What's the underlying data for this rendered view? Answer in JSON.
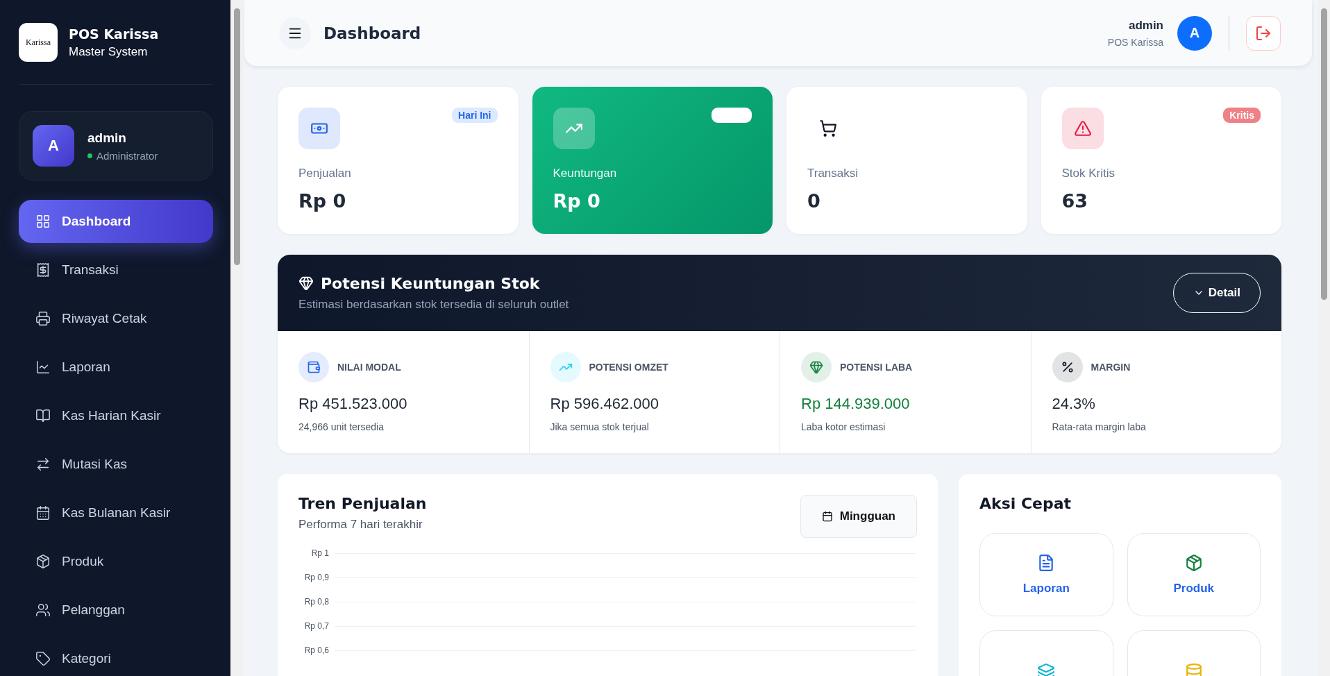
{
  "sidebar": {
    "brand": {
      "logo_text": "Karissa",
      "title": "POS Karissa",
      "subtitle": "Master System"
    },
    "user": {
      "initial": "A",
      "name": "admin",
      "role": "Administrator",
      "online": true
    },
    "items": [
      {
        "label": "Dashboard",
        "selected": true
      },
      {
        "label": "Transaksi",
        "selected": false
      },
      {
        "label": "Riwayat Cetak",
        "selected": false
      },
      {
        "label": "Laporan",
        "selected": false
      },
      {
        "label": "Kas Harian Kasir",
        "selected": false
      },
      {
        "label": "Mutasi Kas",
        "selected": false
      },
      {
        "label": "Kas Bulanan Kasir",
        "selected": false
      },
      {
        "label": "Produk",
        "selected": false
      },
      {
        "label": "Pelanggan",
        "selected": false
      },
      {
        "label": "Kategori",
        "selected": false
      }
    ]
  },
  "header": {
    "title": "Dashboard",
    "user_name": "admin",
    "user_store": "POS Karissa",
    "avatar_initial": "A"
  },
  "stats": [
    {
      "label": "Penjualan",
      "value": "Rp 0",
      "kind": "plain",
      "color": "#2563eb",
      "badge": {
        "text": "Hari Ini",
        "color": "#2563eb",
        "filled": false
      }
    },
    {
      "label": "Keuntungan",
      "value": "Rp 0",
      "kind": "highlight",
      "color": "#ffffff",
      "badge": {
        "color": "#ffffff",
        "filled": true
      }
    },
    {
      "label": "Transaksi",
      "value": "0",
      "kind": "plain",
      "color": "#111827"
    },
    {
      "label": "Stok Kritis",
      "value": "63",
      "kind": "plain",
      "color": "#e11d48",
      "badge": {
        "text": "Kritis",
        "color": "#ef8086",
        "filled": true
      }
    }
  ],
  "potential": {
    "title": "Potensi Keuntungan Stok",
    "subtitle": "Estimasi berdasarkan stok tersedia di seluruh outlet",
    "detail_button": "Detail",
    "metrics": [
      {
        "label": "NILAI MODAL",
        "value": "Rp 451.523.000",
        "note": "24,966 unit tersedia",
        "color": "#2563eb",
        "highlighted": false
      },
      {
        "label": "POTENSI OMZET",
        "value": "Rp 596.462.000",
        "note": "Jika semua stok terjual",
        "color": "#22d3ee",
        "highlighted": false
      },
      {
        "label": "POTENSI LABA",
        "value": "Rp 144.939.000",
        "note": "Laba kotor estimasi",
        "color": "#15803d",
        "highlighted": true
      },
      {
        "label": "MARGIN",
        "value": "24.3%",
        "note": "Rata-rata margin laba",
        "color": "#111827",
        "highlighted": false
      }
    ]
  },
  "sales_trend": {
    "title": "Tren Penjualan",
    "subtitle": "Performa 7 hari terakhir",
    "period_button": "Mingguan",
    "axis_labels": [
      "Rp 1",
      "Rp 0,9",
      "Rp 0,8",
      "Rp 0,7",
      "Rp 0,6"
    ]
  },
  "quick_actions": {
    "title": "Aksi Cepat",
    "items": [
      {
        "label": "Laporan",
        "color": "#2563eb"
      },
      {
        "label": "Produk",
        "color": "#15803d"
      },
      {
        "color": "#06b6d4"
      },
      {
        "color": "#eab308"
      }
    ]
  }
}
